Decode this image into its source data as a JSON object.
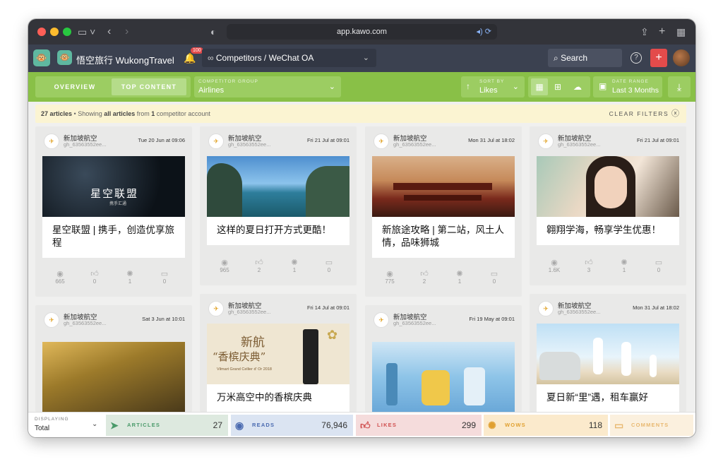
{
  "browser": {
    "url": "app.kawo.com"
  },
  "header": {
    "brand": "悟空旅行 WukongTravel",
    "notif_count": "100",
    "breadcrumb": "Competitors / WeChat OA",
    "search_label": "Search"
  },
  "toolbar": {
    "tabs": [
      {
        "label": "OVERVIEW"
      },
      {
        "label": "TOP CONTENT"
      }
    ],
    "competitor_group_label": "COMPETITOR GROUP",
    "competitor_group_value": "Airlines",
    "sort_label": "SORT BY",
    "sort_value": "Likes",
    "date_label": "DATE RANGE",
    "date_value": "Last 3 Months"
  },
  "banner": {
    "count": "27 articles",
    "text_pre": " • Showing ",
    "bold1": "all articles",
    "text_mid": " from ",
    "bold2": "1",
    "text_post": " competitor account",
    "clear": "CLEAR FILTERS"
  },
  "cards": [
    {
      "account": "新加坡航空",
      "id": "gh_63563552ee...",
      "date": "Tue 20 Jun at 09:06",
      "title": "星空联盟 | 携手，创造优享旅程",
      "image_text": "星空联盟",
      "image_subtext": "携手汇通",
      "reads": "665",
      "likes": "0",
      "wows": "1",
      "comments": "0"
    },
    {
      "account": "新加坡航空",
      "id": "gh_63563552ee...",
      "date": "Fri 21 Jul at 09:01",
      "title": "这样的夏日打开方式更酷！",
      "reads": "965",
      "likes": "2",
      "wows": "1",
      "comments": "0"
    },
    {
      "account": "新加坡航空",
      "id": "gh_63563552ee...",
      "date": "Mon 31 Jul at 18:02",
      "title": "新旅途攻略 | 第二站，风土人情，品味狮城",
      "reads": "775",
      "likes": "2",
      "wows": "1",
      "comments": "0"
    },
    {
      "account": "新加坡航空",
      "id": "gh_63563552ee...",
      "date": "Fri 21 Jul at 09:01",
      "title": "翱翔学海，畅享学生优惠！",
      "reads": "1.6K",
      "likes": "3",
      "wows": "1",
      "comments": "0"
    },
    {
      "account": "新加坡航空",
      "id": "gh_63563552ee...",
      "date": "Sat 3 Jun at 10:01"
    },
    {
      "account": "新加坡航空",
      "id": "gh_63563552ee...",
      "date": "Fri 14 Jul at 09:01",
      "title": "万米高空中的香槟庆典",
      "image_text1": "新航",
      "image_text2": "“香槟庆典”",
      "image_text3": "Vilmart Grand Cellier d' Or 2018"
    },
    {
      "account": "新加坡航空",
      "id": "gh_63563552ee...",
      "date": "Fri 19 May at 09:01"
    },
    {
      "account": "新加坡航空",
      "id": "gh_63563552ee...",
      "date": "Mon 31 Jul at 18:02",
      "title": "夏日新“里”遇，租车赢好"
    }
  ],
  "footer": {
    "displaying_label": "DISPLAYING",
    "displaying_value": "Total",
    "articles_label": "ARTICLES",
    "articles_value": "27",
    "reads_label": "READS",
    "reads_value": "76,946",
    "likes_label": "LIKES",
    "likes_value": "299",
    "wows_label": "WOWS",
    "wows_value": "118",
    "comments_label": "COMMENTS"
  },
  "colors": {
    "accent_green": "#89c047",
    "header_dark": "#3b4150",
    "danger_red": "#e34b4b"
  }
}
